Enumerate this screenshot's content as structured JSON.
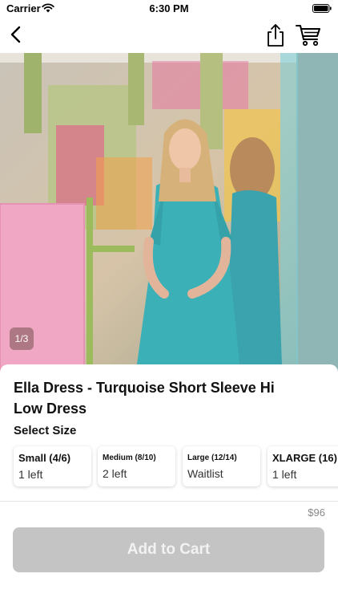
{
  "status_bar": {
    "carrier": "Carrier",
    "time": "6:30 PM"
  },
  "nav": {
    "back_icon": "chevron-left-icon",
    "share_icon": "share-icon",
    "cart_icon": "cart-icon"
  },
  "gallery": {
    "page_indicator": "1/3"
  },
  "product": {
    "title": "Ella Dress - Turquoise Short Sleeve Hi Low Dress",
    "select_size_label": "Select Size",
    "sizes": [
      {
        "name": "Small (4/6)",
        "availability": "1 left"
      },
      {
        "name": "Medium (8/10)",
        "availability": "2 left"
      },
      {
        "name": "Large (12/14)",
        "availability": "Waitlist"
      },
      {
        "name": "XLARGE (16)",
        "availability": "1 left"
      }
    ],
    "price": "$96"
  },
  "cta": {
    "add_to_cart_label": "Add to Cart",
    "disabled_color": "#c4c4c4"
  }
}
